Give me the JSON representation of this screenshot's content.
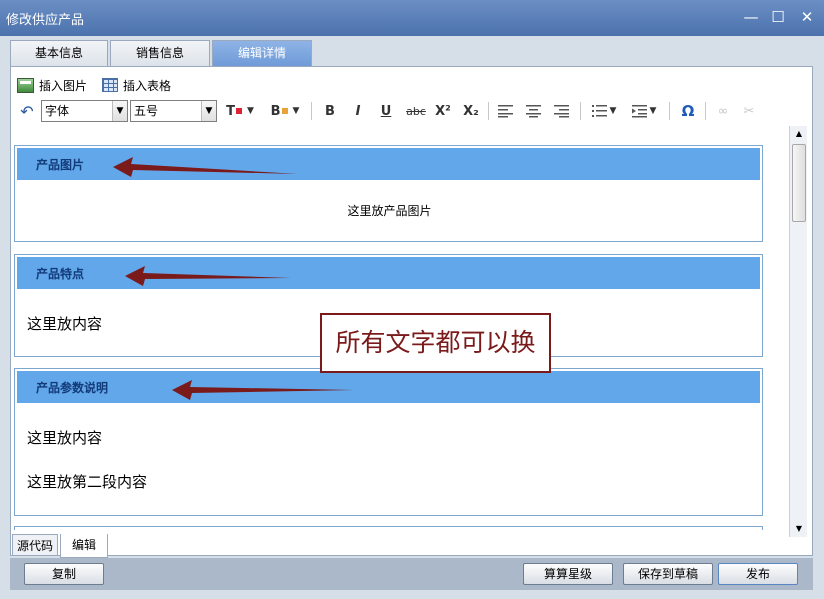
{
  "window": {
    "title": "修改供应产品",
    "controls": {
      "minimize": "—",
      "maximize": "☐",
      "close": "✕"
    }
  },
  "tabs": [
    {
      "label": "基本信息"
    },
    {
      "label": "销售信息"
    },
    {
      "label": "编辑详情",
      "active": true
    }
  ],
  "toolbar1": {
    "insert_image": "插入图片",
    "insert_table": "插入表格"
  },
  "toolbar2": {
    "font_family": "字体",
    "font_size": "五号",
    "undo": "↶",
    "text_color": "T",
    "bg_color": "B",
    "bold": "B",
    "italic": "I",
    "underline": "U",
    "strikethrough": "abc",
    "superscript": "X²",
    "subscript": "X₂",
    "special_char": "Ω",
    "link": "∞",
    "unlink": "✂"
  },
  "sections": [
    {
      "heading": "产品图片",
      "body": [
        "这里放产品图片"
      ]
    },
    {
      "heading": "产品特点",
      "body": [
        "这里放内容"
      ]
    },
    {
      "heading": "产品参数说明",
      "body": [
        "这里放内容",
        "这里放第二段内容"
      ]
    }
  ],
  "callout": "所有文字都可以换",
  "bottom_tabs": [
    {
      "label": "源代码"
    },
    {
      "label": "编辑",
      "active": true
    }
  ],
  "footer": {
    "copy": "复制",
    "calc_rating": "算算星级",
    "save_draft": "保存到草稿",
    "publish": "发布"
  },
  "colors": {
    "section_header": "#62a7ea",
    "arrow": "#7a1a1a",
    "active_tab": "#6f9bd8"
  }
}
